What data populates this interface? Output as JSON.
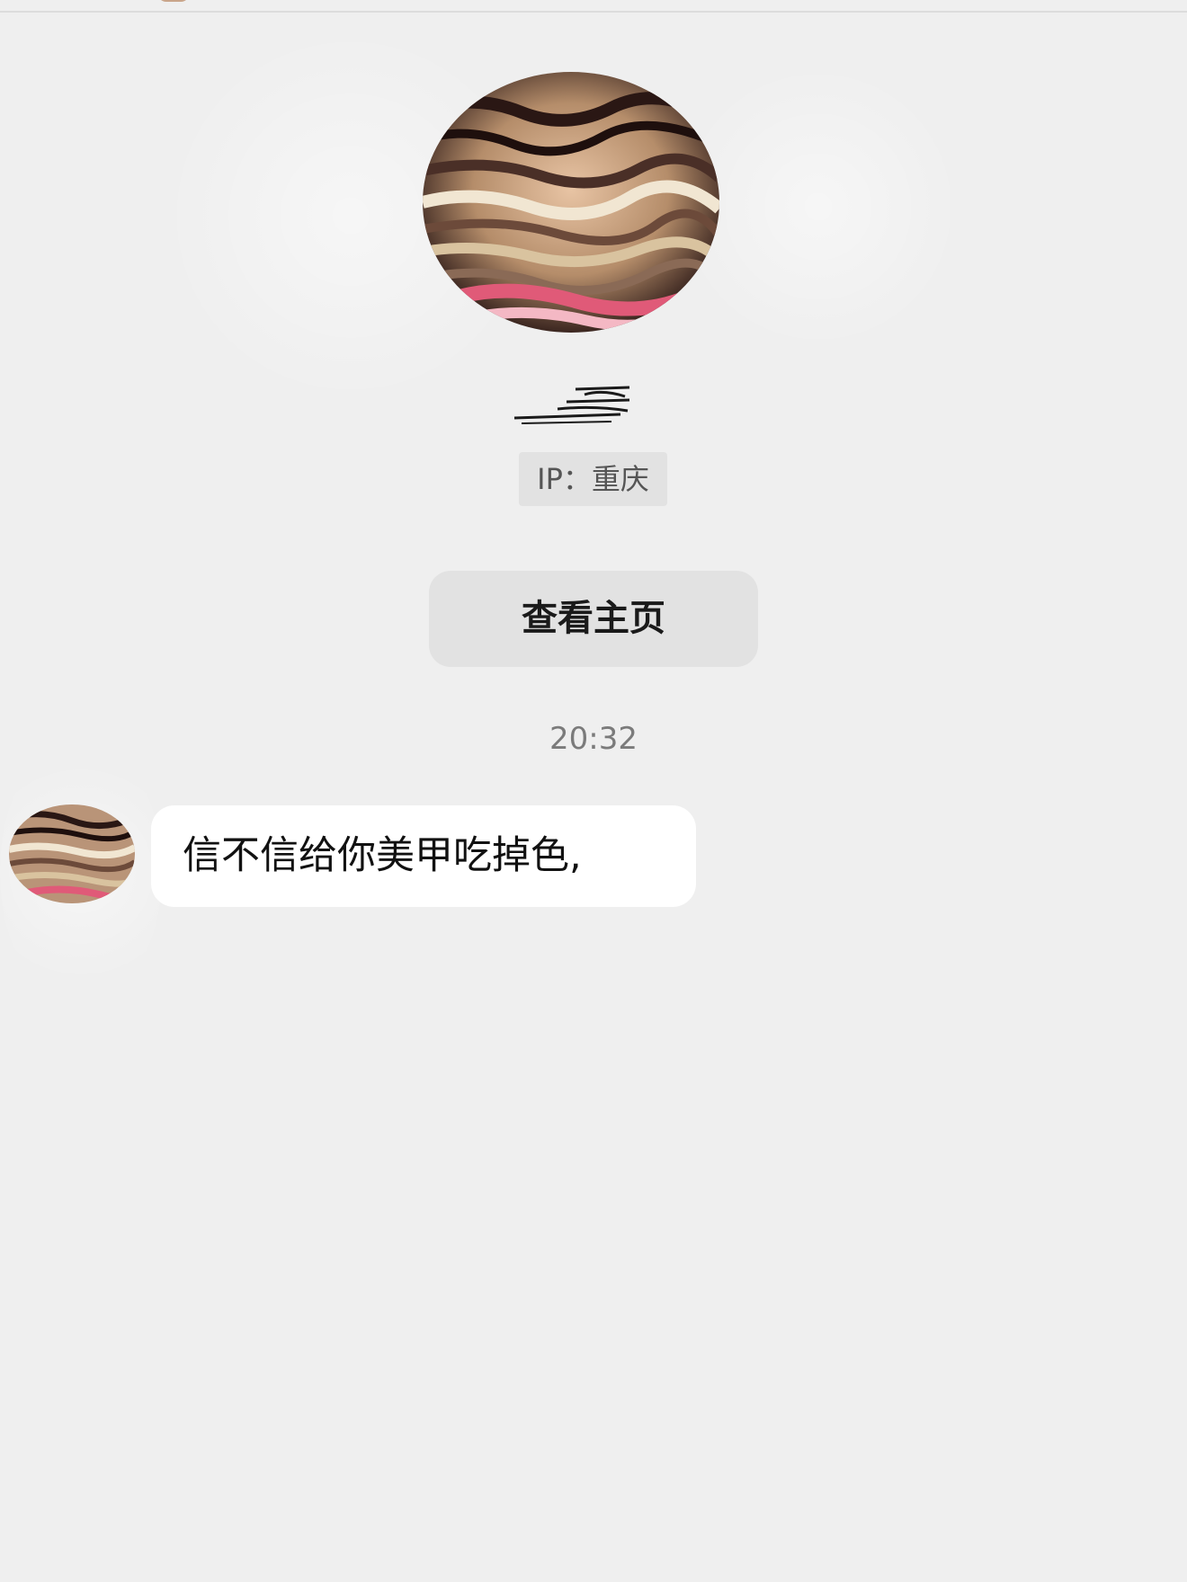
{
  "colors": {
    "background": "#efefef",
    "badge_background": "#e2e2e2",
    "bubble_background": "#ffffff",
    "timestamp_text": "#7b7b7b"
  },
  "profile": {
    "avatar_icon": "blurred-avatar-icon",
    "username_icon": "obscured-username-icon",
    "ip_label": "IP：重庆",
    "view_profile_label": "查看主页"
  },
  "chat": {
    "messages": [
      {
        "time": "20:32",
        "sender_avatar_icon": "blurred-avatar-icon",
        "text": "信不信给你美甲吃掉色,"
      }
    ]
  }
}
